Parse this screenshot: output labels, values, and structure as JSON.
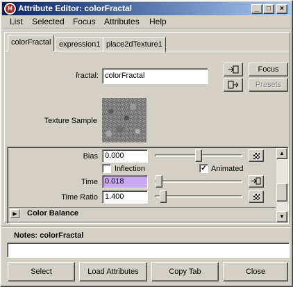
{
  "window": {
    "title": "Attribute Editor: colorFractal",
    "app_icon": "maya-icon",
    "controls": [
      "_",
      "□",
      "×"
    ]
  },
  "menu": [
    "List",
    "Selected",
    "Focus",
    "Attributes",
    "Help"
  ],
  "tabs": [
    {
      "label": "colorFractal",
      "active": true
    },
    {
      "label": "expression1",
      "active": false
    },
    {
      "label": "place2dTexture1",
      "active": false
    }
  ],
  "node": {
    "type_label": "fractal:",
    "name": "colorFractal",
    "focus_label": "Focus",
    "presets_label": "Presets",
    "sample_label": "Texture Sample"
  },
  "attributes": {
    "bias": {
      "label": "Bias",
      "value": "0.000",
      "slider": 0.5
    },
    "inflection": {
      "label": "Inflection",
      "checked": false
    },
    "animated": {
      "label": "Animated",
      "checked": true
    },
    "time": {
      "label": "Time",
      "value": "0.018",
      "slider": 0.018
    },
    "time_ratio": {
      "label": "Time Ratio",
      "value": "1.400",
      "slider": 0.06
    },
    "color_balance": "Color Balance"
  },
  "notes": {
    "label": "Notes:  colorFractal",
    "value": ""
  },
  "bottom_buttons": {
    "select": "Select",
    "load": "Load Attributes",
    "copy": "Copy Tab",
    "close": "Close"
  },
  "colors": {
    "title_start": "#0a246a",
    "title_end": "#a6caf0",
    "keyed_field": "#c8a8f0"
  }
}
